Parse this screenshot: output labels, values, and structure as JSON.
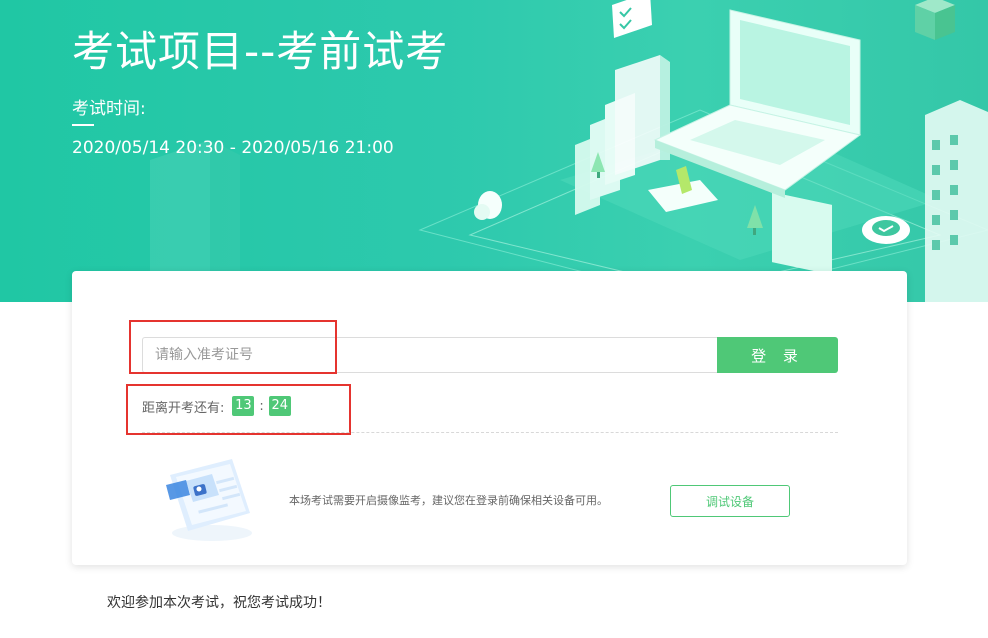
{
  "banner": {
    "title": "考试项目--考前试考",
    "time_label": "考试时间:",
    "time_range": "2020/05/14 20:30 - 2020/05/16 21:00"
  },
  "login": {
    "input_value": "",
    "input_placeholder": "请输入准考证号",
    "button_label": "登 录"
  },
  "countdown": {
    "label": "距离开考还有:",
    "minutes": "13",
    "separator": ":",
    "seconds": "24"
  },
  "device_check": {
    "notice": "本场考试需要开启摄像监考，建议您在登录前确保相关设备可用。",
    "button_label": "调试设备"
  },
  "footer": {
    "welcome": "欢迎参加本次考试，祝您考试成功！"
  },
  "colors": {
    "banner": "#2ec9ab",
    "accent_green": "#4fc877",
    "highlight_red": "#e5342f"
  },
  "icons": [
    "laptop-illustration",
    "checklist-bubble-icon",
    "cloud-icon",
    "plant-icon",
    "building-icon",
    "camera-screen-illustration"
  ]
}
